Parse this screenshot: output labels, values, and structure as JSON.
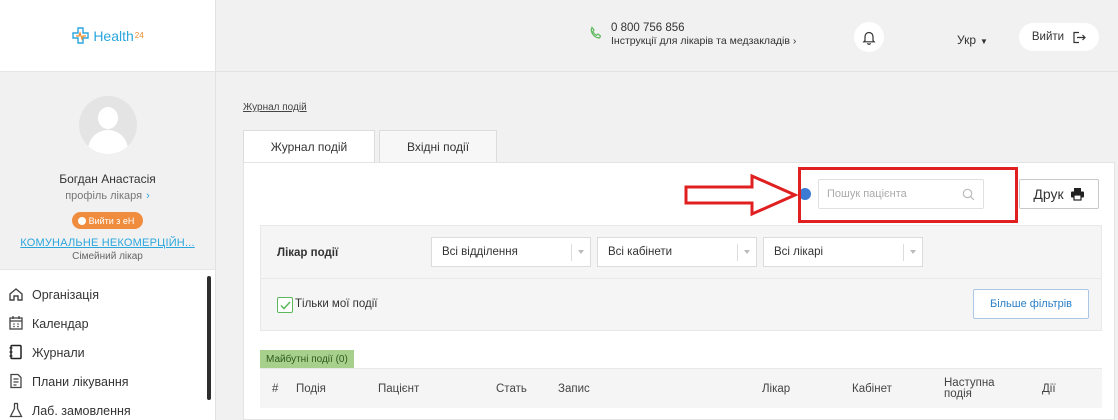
{
  "app": {
    "logo_text": "Health",
    "logo_sup": "24"
  },
  "profile": {
    "name": "Богдан Анастасія",
    "role": "профіль лікаря",
    "role_chevron": "›",
    "eh_badge": "Вийти з еН",
    "org": "КОМУНАЛЬНЕ НЕКОМЕРЦІЙН...",
    "org_role": "Сімейний лікар"
  },
  "nav": {
    "items": [
      {
        "label": "Організація",
        "icon": "home-icon"
      },
      {
        "label": "Календар",
        "icon": "calendar-icon"
      },
      {
        "label": "Журнали",
        "icon": "journal-icon"
      },
      {
        "label": "Плани лікування",
        "icon": "treatment-plan-icon"
      },
      {
        "label": "Лаб. замовлення",
        "icon": "lab-flask-icon"
      }
    ]
  },
  "topbar": {
    "phone": "0 800 756 856",
    "phone_sub": "Інструкції для лікарів та медзакладів ›",
    "language": "Укр",
    "logout": "Вийти"
  },
  "main": {
    "breadcrumb": "Журнал подій",
    "tabs": [
      {
        "label": "Журнал подій",
        "active": true
      },
      {
        "label": "Вхідні події",
        "active": false
      }
    ],
    "search_placeholder": "Пошук пацієнта",
    "print": "Друк",
    "filters": {
      "label": "Лікар події",
      "department": "Всі відділення",
      "cabinet": "Всі кабінети",
      "doctor": "Всі лікарі"
    },
    "only_mine": "Тільки мої події",
    "only_mine_checked": true,
    "more_filters": "Більше фільтрів",
    "future_badge": "Майбутні події (0)",
    "columns": [
      "#",
      "Подія",
      "Пацієнт",
      "Стать",
      "Запис",
      "Лікар",
      "Кабінет",
      "Наступна подія",
      "Дії"
    ]
  },
  "colors": {
    "accent": "#2ba6dd",
    "badge_orange": "#f08c3d",
    "annotation_red": "#e02020",
    "success_green": "#5cb85c"
  }
}
